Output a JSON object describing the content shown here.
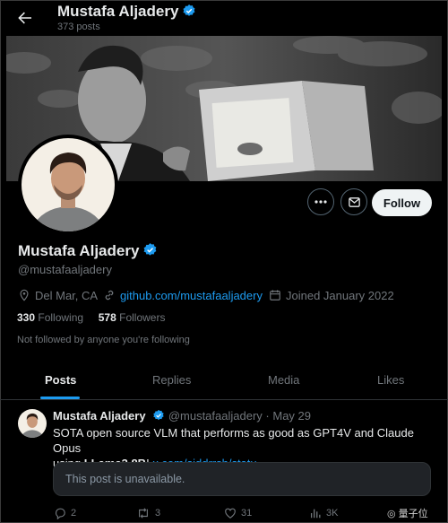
{
  "header": {
    "name": "Mustafa Aljadery",
    "posts_count": "373 posts"
  },
  "profile": {
    "name": "Mustafa Aljadery",
    "handle": "@mustafaaljadery",
    "location": "Del Mar, CA",
    "website": "github.com/mustafaaljadery",
    "joined": "Joined January 2022",
    "following_count": "330",
    "following_label": "Following",
    "followers_count": "578",
    "followers_label": "Followers",
    "not_followed_text": "Not followed by anyone you're following"
  },
  "buttons": {
    "follow": "Follow"
  },
  "tabs": [
    {
      "label": "Posts",
      "active": true
    },
    {
      "label": "Replies",
      "active": false
    },
    {
      "label": "Media",
      "active": false
    },
    {
      "label": "Likes",
      "active": false
    }
  ],
  "post": {
    "author_name": "Mustafa Aljadery",
    "author_handle": "@mustafaaljadery",
    "separator": "·",
    "date": "May 29",
    "text_line1": "SOTA open source VLM that performs as good as GPT4V and Claude Opus",
    "text_line2_prefix": "using ",
    "text_bold": "LLama3 8B",
    "text_after_bold": "! ",
    "link": "x.com/siddrrsh/statu…",
    "quote_unavailable": "This post is unavailable.",
    "replies": "2",
    "reposts": "3",
    "likes": "31",
    "views": "3K"
  },
  "watermark": "量子位",
  "colors": {
    "accent": "#1d9bf0",
    "background": "#000000",
    "text_primary": "#e7e9ea",
    "text_secondary": "#71767b"
  },
  "icons": [
    "back-arrow-icon",
    "verified-badge-icon",
    "more-icon",
    "message-icon",
    "location-icon",
    "link-icon",
    "calendar-icon",
    "reply-icon",
    "repost-icon",
    "like-icon",
    "views-icon"
  ]
}
